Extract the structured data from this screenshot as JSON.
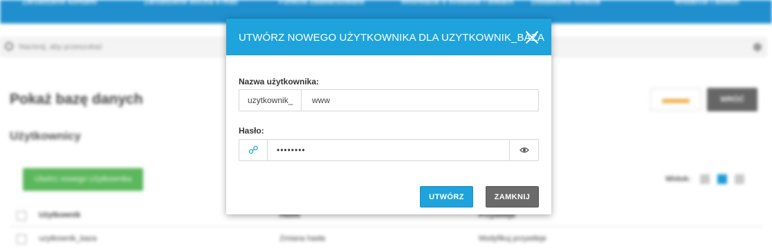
{
  "background": {
    "nav": [
      "Zarządzanie kontami",
      "Zarządzanie pocztą e-mail",
      "Funkcje zaawansowane",
      "Informacje o systemie i plikach",
      "Dodatkowe funkcje",
      "Wsparcie i pomoc"
    ],
    "search_placeholder": "Nacisnij, aby przeszukać",
    "page_title": "Pokaż bazę danych",
    "section_title": "Użytkownicy",
    "back_label": "WRÓĆ",
    "create_user_label": "Utwórz nowego Użytkownika",
    "view_label": "Widok:",
    "table": {
      "headers": [
        "Użytkownik",
        "Hasło",
        "Przywileje"
      ],
      "rows": [
        [
          "uzytkownik_baza",
          "Zmiana hasła",
          "Modyfikuj przywileje"
        ]
      ]
    }
  },
  "modal": {
    "title": "UTWÓRZ NOWEGO UŻYTKOWNIKA DLA UZYTKOWNIK_BAZA",
    "username_label": "Nazwa użytkownika:",
    "username_prefix": "uzytkownik_",
    "username_value": "www",
    "password_label": "Hasło:",
    "password_value": "password",
    "create_label": "UTWÓRZ",
    "close_label": "ZAMKNIJ"
  },
  "colors": {
    "accent": "#1fa3dc",
    "nav": "#1f8fce",
    "close_button": "#6a6a6a",
    "green_button": "#5cb85c"
  }
}
